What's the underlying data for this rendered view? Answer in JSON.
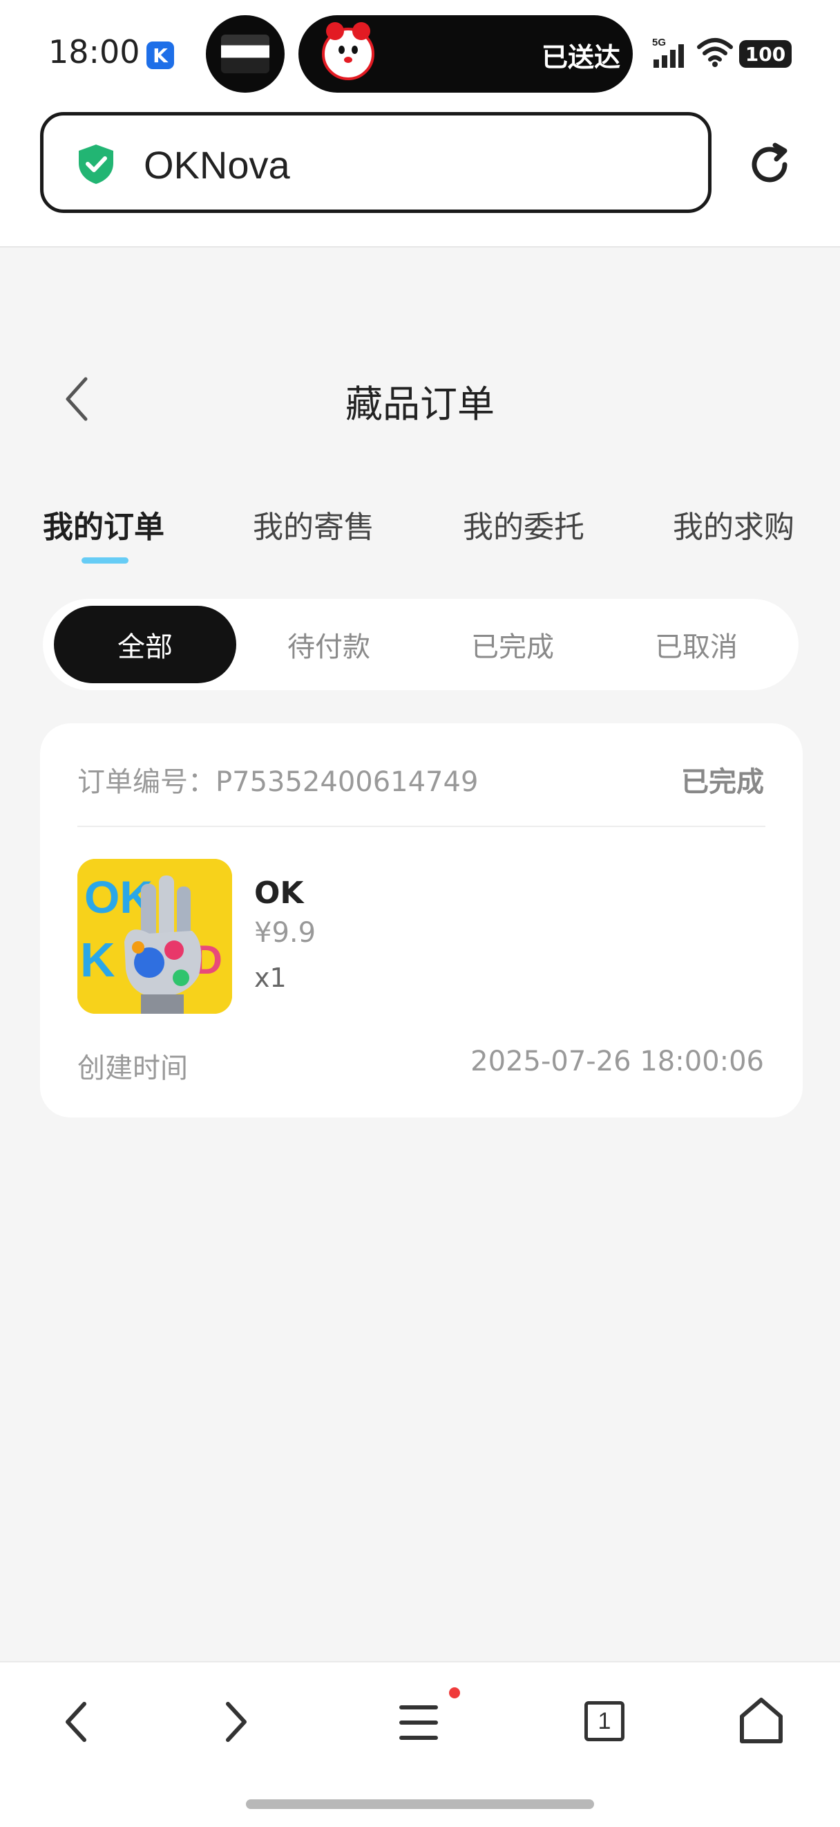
{
  "status_bar": {
    "time": "18:00",
    "app_badge": "K",
    "notification_text": "已送达",
    "network": "5G",
    "battery": "100"
  },
  "browser": {
    "url": "OKNova"
  },
  "page": {
    "title": "藏品订单"
  },
  "tabs": [
    {
      "label": "我的订单",
      "active": true
    },
    {
      "label": "我的寄售",
      "active": false
    },
    {
      "label": "我的委托",
      "active": false
    },
    {
      "label": "我的求购",
      "active": false
    }
  ],
  "filters": [
    {
      "label": "全部",
      "active": true
    },
    {
      "label": "待付款",
      "active": false
    },
    {
      "label": "已完成",
      "active": false
    },
    {
      "label": "已取消",
      "active": false
    }
  ],
  "order": {
    "number_label": "订单编号：P75352400614749",
    "status": "已完成",
    "product_name": "OK",
    "price": "¥9.9",
    "quantity": "x1",
    "created_label": "创建时间",
    "created_time": "2025-07-26 18:00:06",
    "image_text": "OK"
  },
  "bottom_nav": {
    "tab_count": "1"
  },
  "colors": {
    "accent_indicator": "#66ccf5",
    "active_filter_bg": "#121212",
    "shield": "#22b573"
  }
}
